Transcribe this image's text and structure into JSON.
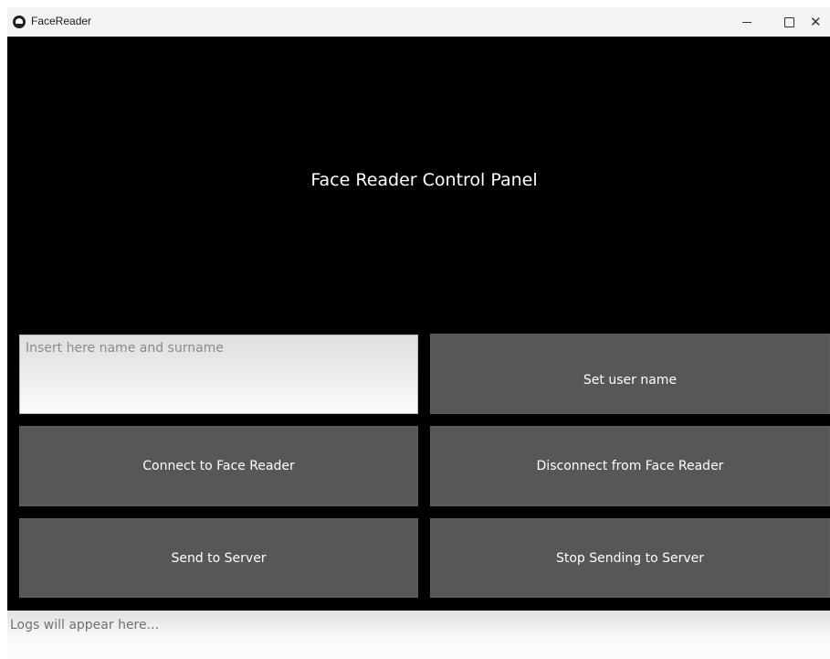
{
  "window": {
    "title": "FaceReader",
    "app_icon": "facereader-app-icon",
    "controls": {
      "minimize": "minimize-icon",
      "maximize": "maximize-icon",
      "close": "close-icon",
      "close_glyph": "✕"
    }
  },
  "panel": {
    "title": "Face Reader Control Panel"
  },
  "user_name": {
    "value": "",
    "placeholder": "Insert here name and surname",
    "set_button_label": "Set user name"
  },
  "actions": {
    "connect_label": "Connect to Face Reader",
    "disconnect_label": "Disconnect from Face Reader",
    "send_label": "Send to Server",
    "stop_label": "Stop Sending to Server"
  },
  "log": {
    "value": "",
    "placeholder": "Logs will appear here..."
  },
  "colors": {
    "background": "#000000",
    "button": "#575757",
    "button_text": "#ffffff",
    "titlebar": "#f3f3f3"
  }
}
